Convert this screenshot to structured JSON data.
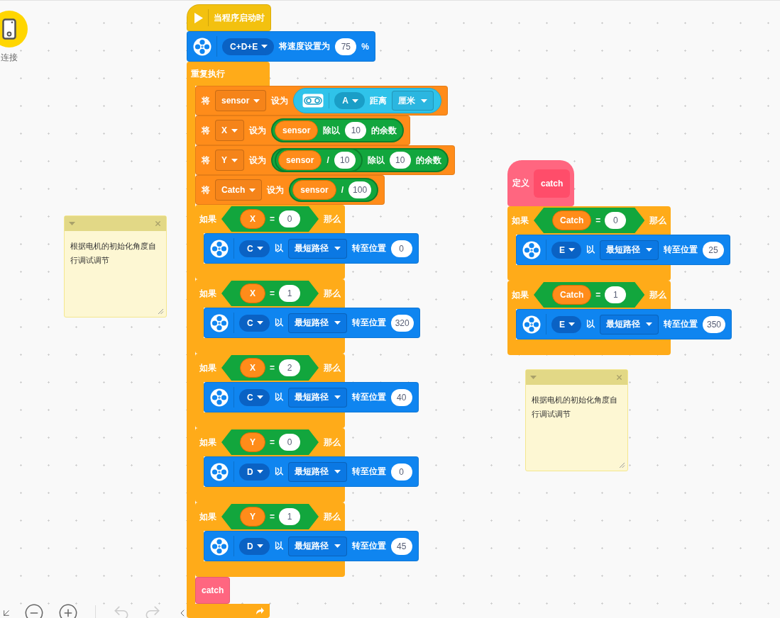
{
  "device": {
    "label": "连接"
  },
  "scripts": [
    {
      "blocks": [
        {
          "kind": "when_start",
          "label": "当程序启动时"
        },
        {
          "kind": "motor",
          "parts": [
            {
              "kind": "port",
              "text": "C+D+E"
            },
            {
              "kind": "text",
              "text": "将速度设置为"
            },
            {
              "kind": "num",
              "text": "75"
            },
            {
              "kind": "text",
              "text": "%"
            }
          ]
        },
        {
          "kind": "forever",
          "label": "重复执行",
          "children": [
            {
              "kind": "set_variable",
              "parts": [
                {
                  "kind": "text",
                  "text": "将"
                },
                {
                  "kind": "var_menu",
                  "text": "sensor"
                },
                {
                  "kind": "text",
                  "text": "设为"
                },
                {
                  "kind": "sensor",
                  "parts": [
                    {
                      "kind": "port",
                      "text": "A"
                    },
                    {
                      "kind": "text",
                      "text": "距离"
                    },
                    {
                      "kind": "menu",
                      "text": "厘米"
                    }
                  ]
                }
              ]
            },
            {
              "kind": "set_variable",
              "parts": [
                {
                  "kind": "text",
                  "text": "将"
                },
                {
                  "kind": "var_menu",
                  "text": "X"
                },
                {
                  "kind": "text",
                  "text": "设为"
                },
                {
                  "kind": "op",
                  "parts": [
                    {
                      "kind": "var",
                      "text": "sensor"
                    },
                    {
                      "kind": "text",
                      "text": "除以"
                    },
                    {
                      "kind": "num",
                      "text": "10"
                    },
                    {
                      "kind": "text",
                      "text": "的余数"
                    }
                  ]
                }
              ]
            },
            {
              "kind": "set_variable",
              "parts": [
                {
                  "kind": "text",
                  "text": "将"
                },
                {
                  "kind": "var_menu",
                  "text": "Y"
                },
                {
                  "kind": "text",
                  "text": "设为"
                },
                {
                  "kind": "op",
                  "parts": [
                    {
                      "kind": "op",
                      "parts": [
                        {
                          "kind": "var",
                          "text": "sensor"
                        },
                        {
                          "kind": "text",
                          "text": "/"
                        },
                        {
                          "kind": "num",
                          "text": "10"
                        }
                      ]
                    },
                    {
                      "kind": "text",
                      "text": "除以"
                    },
                    {
                      "kind": "num",
                      "text": "10"
                    },
                    {
                      "kind": "text",
                      "text": "的余数"
                    }
                  ]
                }
              ]
            },
            {
              "kind": "set_variable",
              "parts": [
                {
                  "kind": "text",
                  "text": "将"
                },
                {
                  "kind": "var_menu",
                  "text": "Catch"
                },
                {
                  "kind": "text",
                  "text": "设为"
                },
                {
                  "kind": "op",
                  "parts": [
                    {
                      "kind": "var",
                      "text": "sensor"
                    },
                    {
                      "kind": "text",
                      "text": "/"
                    },
                    {
                      "kind": "num",
                      "text": "100"
                    }
                  ]
                }
              ]
            },
            {
              "kind": "if",
              "parts": [
                {
                  "kind": "text",
                  "text": "如果"
                },
                {
                  "kind": "compare",
                  "parts": [
                    {
                      "kind": "var",
                      "text": "X"
                    },
                    {
                      "kind": "text",
                      "text": "="
                    },
                    {
                      "kind": "num",
                      "text": "0"
                    }
                  ]
                },
                {
                  "kind": "text",
                  "text": "那么"
                }
              ],
              "children": [
                {
                  "kind": "motor",
                  "parts": [
                    {
                      "kind": "port",
                      "text": "C"
                    },
                    {
                      "kind": "text",
                      "text": "以"
                    },
                    {
                      "kind": "menu",
                      "text": "最短路径"
                    },
                    {
                      "kind": "text",
                      "text": "转至位置"
                    },
                    {
                      "kind": "num",
                      "text": "0"
                    }
                  ]
                }
              ]
            },
            {
              "kind": "if",
              "parts": [
                {
                  "kind": "text",
                  "text": "如果"
                },
                {
                  "kind": "compare",
                  "parts": [
                    {
                      "kind": "var",
                      "text": "X"
                    },
                    {
                      "kind": "text",
                      "text": "="
                    },
                    {
                      "kind": "num",
                      "text": "1"
                    }
                  ]
                },
                {
                  "kind": "text",
                  "text": "那么"
                }
              ],
              "children": [
                {
                  "kind": "motor",
                  "parts": [
                    {
                      "kind": "port",
                      "text": "C"
                    },
                    {
                      "kind": "text",
                      "text": "以"
                    },
                    {
                      "kind": "menu",
                      "text": "最短路径"
                    },
                    {
                      "kind": "text",
                      "text": "转至位置"
                    },
                    {
                      "kind": "num",
                      "text": "320"
                    }
                  ]
                }
              ]
            },
            {
              "kind": "if",
              "parts": [
                {
                  "kind": "text",
                  "text": "如果"
                },
                {
                  "kind": "compare",
                  "parts": [
                    {
                      "kind": "var",
                      "text": "X"
                    },
                    {
                      "kind": "text",
                      "text": "="
                    },
                    {
                      "kind": "num",
                      "text": "2"
                    }
                  ]
                },
                {
                  "kind": "text",
                  "text": "那么"
                }
              ],
              "children": [
                {
                  "kind": "motor",
                  "parts": [
                    {
                      "kind": "port",
                      "text": "C"
                    },
                    {
                      "kind": "text",
                      "text": "以"
                    },
                    {
                      "kind": "menu",
                      "text": "最短路径"
                    },
                    {
                      "kind": "text",
                      "text": "转至位置"
                    },
                    {
                      "kind": "num",
                      "text": "40"
                    }
                  ]
                }
              ]
            },
            {
              "kind": "if",
              "parts": [
                {
                  "kind": "text",
                  "text": "如果"
                },
                {
                  "kind": "compare",
                  "parts": [
                    {
                      "kind": "var",
                      "text": "Y"
                    },
                    {
                      "kind": "text",
                      "text": "="
                    },
                    {
                      "kind": "num",
                      "text": "0"
                    }
                  ]
                },
                {
                  "kind": "text",
                  "text": "那么"
                }
              ],
              "children": [
                {
                  "kind": "motor",
                  "parts": [
                    {
                      "kind": "port",
                      "text": "D"
                    },
                    {
                      "kind": "text",
                      "text": "以"
                    },
                    {
                      "kind": "menu",
                      "text": "最短路径"
                    },
                    {
                      "kind": "text",
                      "text": "转至位置"
                    },
                    {
                      "kind": "num",
                      "text": "0"
                    }
                  ]
                }
              ]
            },
            {
              "kind": "if",
              "parts": [
                {
                  "kind": "text",
                  "text": "如果"
                },
                {
                  "kind": "compare",
                  "parts": [
                    {
                      "kind": "var",
                      "text": "Y"
                    },
                    {
                      "kind": "text",
                      "text": "="
                    },
                    {
                      "kind": "num",
                      "text": "1"
                    }
                  ]
                },
                {
                  "kind": "text",
                  "text": "那么"
                }
              ],
              "children": [
                {
                  "kind": "motor",
                  "parts": [
                    {
                      "kind": "port",
                      "text": "D"
                    },
                    {
                      "kind": "text",
                      "text": "以"
                    },
                    {
                      "kind": "menu",
                      "text": "最短路径"
                    },
                    {
                      "kind": "text",
                      "text": "转至位置"
                    },
                    {
                      "kind": "num",
                      "text": "45"
                    }
                  ]
                }
              ]
            },
            {
              "kind": "call",
              "label": "catch"
            }
          ]
        }
      ]
    },
    {
      "blocks": [
        {
          "kind": "define",
          "label": "定义",
          "name": "catch"
        },
        {
          "kind": "if",
          "parts": [
            {
              "kind": "text",
              "text": "如果"
            },
            {
              "kind": "compare",
              "parts": [
                {
                  "kind": "var",
                  "text": "Catch"
                },
                {
                  "kind": "text",
                  "text": "="
                },
                {
                  "kind": "num",
                  "text": "0"
                }
              ]
            },
            {
              "kind": "text",
              "text": "那么"
            }
          ],
          "children": [
            {
              "kind": "motor",
              "parts": [
                {
                  "kind": "port",
                  "text": "E"
                },
                {
                  "kind": "text",
                  "text": "以"
                },
                {
                  "kind": "menu",
                  "text": "最短路径"
                },
                {
                  "kind": "text",
                  "text": "转至位置"
                },
                {
                  "kind": "num",
                  "text": "25"
                }
              ]
            }
          ]
        },
        {
          "kind": "if",
          "parts": [
            {
              "kind": "text",
              "text": "如果"
            },
            {
              "kind": "compare",
              "parts": [
                {
                  "kind": "var",
                  "text": "Catch"
                },
                {
                  "kind": "text",
                  "text": "="
                },
                {
                  "kind": "num",
                  "text": "1"
                }
              ]
            },
            {
              "kind": "text",
              "text": "那么"
            }
          ],
          "children": [
            {
              "kind": "motor",
              "parts": [
                {
                  "kind": "port",
                  "text": "E"
                },
                {
                  "kind": "text",
                  "text": "以"
                },
                {
                  "kind": "menu",
                  "text": "最短路径"
                },
                {
                  "kind": "text",
                  "text": "转至位置"
                },
                {
                  "kind": "num",
                  "text": "350"
                }
              ]
            }
          ]
        }
      ]
    }
  ],
  "notes": [
    {
      "text": "根据电机的初始化角度自行调试调节"
    },
    {
      "text": "根据电机的初始化角度自行调试调节"
    }
  ],
  "toolbar": {
    "undo": {
      "disabled": true
    },
    "redo": {
      "disabled": true
    }
  }
}
